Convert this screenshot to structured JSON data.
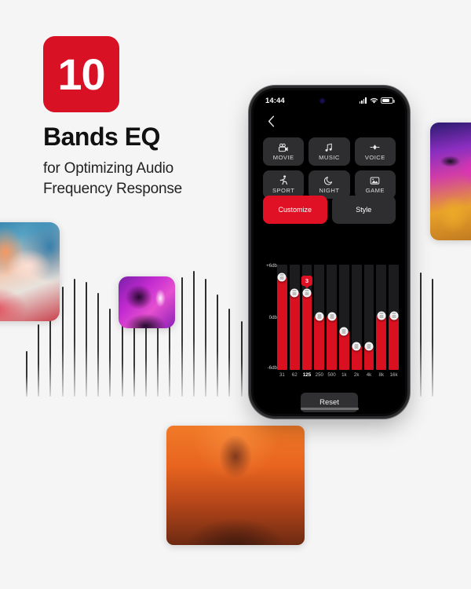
{
  "hero": {
    "badge_number": "10",
    "title": "Bands EQ",
    "subtitle_line1": "for Optimizing Audio",
    "subtitle_line2": "Frequency Response",
    "badge_color": "#d81124"
  },
  "phone": {
    "status_bar": {
      "time": "14:44",
      "signal_icon": "cellular-signal-icon",
      "wifi_icon": "wifi-icon",
      "battery_icon": "battery-icon"
    },
    "nav": {
      "back_icon": "chevron-left-icon"
    },
    "presets": [
      {
        "label": "MOVIE",
        "icon": "movie-camera-icon",
        "glyph": "🎥"
      },
      {
        "label": "MUSIC",
        "icon": "music-note-icon",
        "glyph": "♫"
      },
      {
        "label": "VOICE",
        "icon": "voice-diamond-icon",
        "glyph": "◆"
      },
      {
        "label": "SPORT",
        "icon": "running-person-icon",
        "glyph": "🏃"
      },
      {
        "label": "NIGHT",
        "icon": "moon-icon",
        "glyph": "☾"
      },
      {
        "label": "GAME",
        "icon": "game-image-icon",
        "glyph": "▣"
      }
    ],
    "modes": [
      {
        "label": "Customize",
        "active": true
      },
      {
        "label": "Style",
        "active": false
      }
    ],
    "reset_label": "Reset",
    "accent_color": "#e11125",
    "fill_color": "#d8101f"
  },
  "chart_data": {
    "type": "bar",
    "title": "10 Bands EQ",
    "xlabel": "",
    "ylabel": "db",
    "ylim": [
      -6,
      6
    ],
    "grid": false,
    "legend": "none",
    "axis_ticks": [
      "+6db",
      "0db",
      "-6db"
    ],
    "categories": [
      "31",
      "62",
      "125",
      "250",
      "500",
      "1k",
      "2k",
      "4k",
      "8k",
      "16k"
    ],
    "values": [
      4.6,
      2.8,
      2.8,
      0.1,
      0.1,
      -1.6,
      -3.3,
      -3.3,
      0.2,
      0.2
    ],
    "selected_index": 2,
    "selected_label": "125",
    "selected_value": "3",
    "tooltip": "3"
  }
}
